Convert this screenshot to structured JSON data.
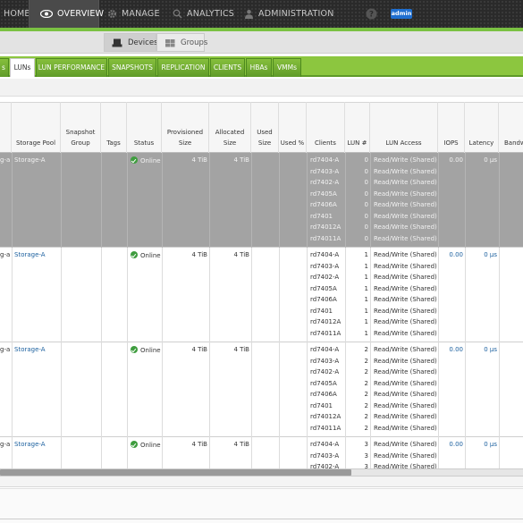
{
  "nav": {
    "home": "HOME",
    "overview": "OVERVIEW",
    "manage": "MANAGE",
    "analytics": "ANALYTICS",
    "administration": "ADMINISTRATION",
    "user_badge": "admin"
  },
  "subtabs": {
    "devices": "Devices",
    "groups": "Groups"
  },
  "tabs": {
    "partial": "s",
    "luns": "LUNs",
    "lun_performance": "LUN PERFORMANCE",
    "snapshots": "SNAPSHOTS",
    "replication": "REPLICATION",
    "clients": "CLIENTS",
    "hbas": "HBAs",
    "vmms": "VMMs"
  },
  "columns": {
    "storage_pool": "Storage Pool",
    "snapshot_group": "Snapshot Group",
    "tags": "Tags",
    "status": "Status",
    "provisioned_size": "Provisioned Size",
    "allocated_size": "Allocated Size",
    "used_size": "Used Size",
    "used_pct": "Used %",
    "clients": "Clients",
    "lun_num": "LUN #",
    "lun_access": "LUN Access",
    "iops": "IOPS",
    "latency": "Latency",
    "bandwidth": "Bandw"
  },
  "rows": [
    {
      "name_fragment": "g-a",
      "pool": "Storage-A",
      "status": "Online",
      "prov": "4 TiB",
      "alloc": "4 TiB",
      "iops": "0.00",
      "latency": "0 µs",
      "lun": "0",
      "access": "Read/Write (Shared)",
      "clients": [
        "rd7404-A",
        "rd7403-A",
        "rd7402-A",
        "rd7405A",
        "rd7406A",
        "rd7401",
        "rd74012A",
        "rd74011A"
      ]
    },
    {
      "name_fragment": "g-a",
      "pool": "Storage-A",
      "status": "Online",
      "prov": "4 TiB",
      "alloc": "4 TiB",
      "iops": "0.00",
      "latency": "0 µs",
      "lun": "1",
      "access": "Read/Write (Shared)",
      "clients": [
        "rd7404-A",
        "rd7403-A",
        "rd7402-A",
        "rd7405A",
        "rd7406A",
        "rd7401",
        "rd74012A",
        "rd74011A"
      ]
    },
    {
      "name_fragment": "g-a",
      "pool": "Storage-A",
      "status": "Online",
      "prov": "4 TiB",
      "alloc": "4 TiB",
      "iops": "0.00",
      "latency": "0 µs",
      "lun": "2",
      "access": "Read/Write (Shared)",
      "clients": [
        "rd7404-A",
        "rd7403-A",
        "rd7402-A",
        "rd7405A",
        "rd7406A",
        "rd7401",
        "rd74012A",
        "rd74011A"
      ]
    },
    {
      "name_fragment": "g-a",
      "pool": "Storage-A",
      "status": "Online",
      "prov": "4 TiB",
      "alloc": "4 TiB",
      "iops": "0.00",
      "latency": "0 µs",
      "lun": "3",
      "access": "Read/Write (Shared)",
      "clients": [
        "rd7404-A",
        "rd7403-A",
        "rd7402-A"
      ]
    }
  ],
  "colors": {
    "brand_green": "#8cc63f",
    "link_blue": "#1a5f9e",
    "status_green": "#3f9d3f",
    "admin_badge": "#1f6fd0"
  },
  "icons": {
    "overview": "eye-icon",
    "manage": "gear-icon",
    "analytics": "search-icon",
    "administration": "person-icon",
    "devices": "server-icon",
    "groups": "group-icon",
    "status": "check-circle-icon"
  }
}
